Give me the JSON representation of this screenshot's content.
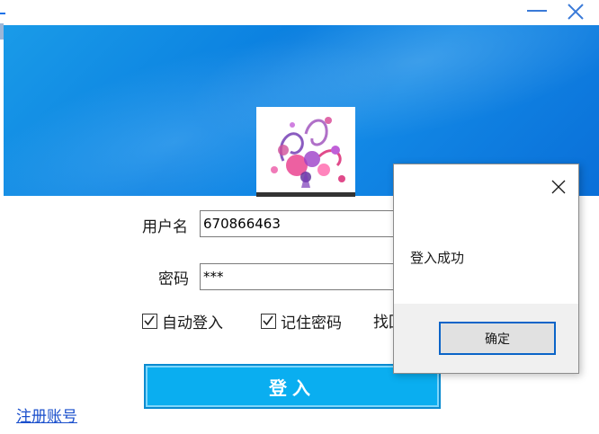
{
  "window": {
    "minimize_icon": "minimize-icon",
    "close_icon": "close-icon",
    "accent_color": "#0a7fe0"
  },
  "login": {
    "username_label": "用户名",
    "username_value": "670866463",
    "password_label": "密码",
    "password_value": "***",
    "auto_login_label": "自动登入",
    "auto_login_checked": true,
    "remember_label": "记住密码",
    "remember_checked": true,
    "find_password_label": "找回密码",
    "login_button": "登入",
    "register_link": "注册账号",
    "button_color": "#0aaef0"
  },
  "dialog": {
    "message": "登入成功",
    "ok_button": "确定",
    "close_icon": "close-icon"
  }
}
